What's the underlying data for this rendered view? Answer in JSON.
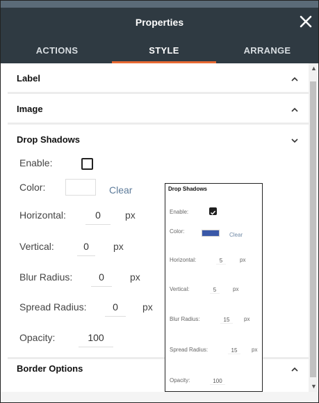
{
  "header": {
    "title": "Properties",
    "close_icon": "close-icon"
  },
  "tabs": [
    {
      "label": "ACTIONS",
      "active": false
    },
    {
      "label": "STYLE",
      "active": true
    },
    {
      "label": "ARRANGE",
      "active": false
    }
  ],
  "sections": {
    "label": {
      "title": "Label",
      "expanded": false
    },
    "image": {
      "title": "Image",
      "expanded": false
    },
    "drop_shadows": {
      "title": "Drop Shadows",
      "expanded": true,
      "enable_label": "Enable:",
      "enabled": false,
      "color_label": "Color:",
      "clear_label": "Clear",
      "horizontal_label": "Horizontal:",
      "horizontal_value": "0",
      "vertical_label": "Vertical:",
      "vertical_value": "0",
      "blur_label": "Blur Radius:",
      "blur_value": "0",
      "spread_label": "Spread Radius:",
      "spread_value": "0",
      "opacity_label": "Opacity:",
      "opacity_value": "100",
      "unit": "px"
    },
    "border_options": {
      "title": "Border Options",
      "expanded": false
    }
  },
  "preview": {
    "title": "Drop Shadows",
    "enable_label": "Enable:",
    "enabled": true,
    "color_label": "Color:",
    "color": "#3a58a8",
    "clear_label": "Clear",
    "horizontal_label": "Horizontal:",
    "horizontal_value": "5",
    "vertical_label": "Vertical:",
    "vertical_value": "5",
    "blur_label": "Blur Radius:",
    "blur_value": "15",
    "spread_label": "Spread Radius:",
    "spread_value": "15",
    "opacity_label": "Opacity:",
    "opacity_value": "100",
    "unit": "px"
  },
  "colors": {
    "header_bg": "#2f3a42",
    "accent": "#e86a33",
    "link": "#5d7b9a"
  }
}
